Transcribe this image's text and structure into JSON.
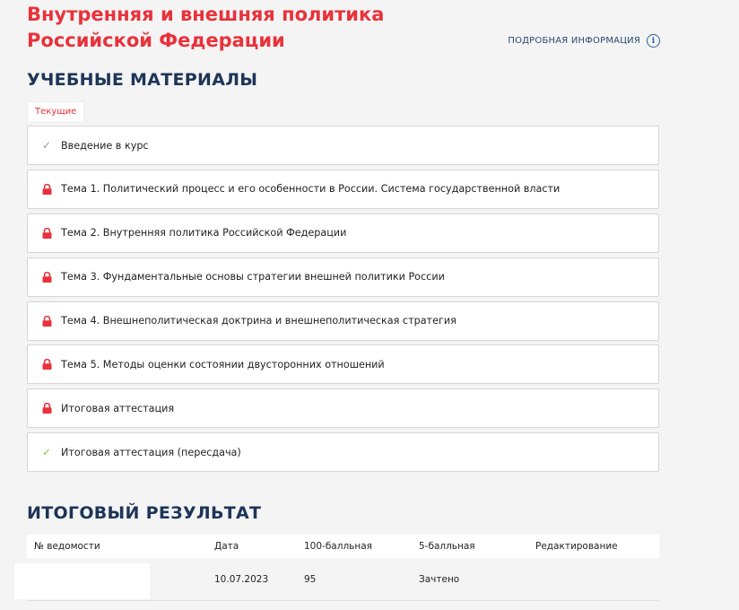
{
  "page": {
    "title": "Внутренняя и внешняя политика Российской Федерации",
    "more_info_label": "ПОДРОБНАЯ ИНФОРМАЦИЯ",
    "more_info_icon": "info-icon"
  },
  "materials": {
    "heading": "УЧЕБНЫЕ МАТЕРИАЛЫ",
    "tab_label": "Текущие",
    "items": [
      {
        "status": "done",
        "icon": "check-icon",
        "label": "Введение в курс"
      },
      {
        "status": "locked",
        "icon": "lock-icon",
        "label": "Тема 1. Политический процесс и его особенности в России. Система государственной власти"
      },
      {
        "status": "locked",
        "icon": "lock-icon",
        "label": "Тема 2. Внутренняя политика Российской Федерации"
      },
      {
        "status": "locked",
        "icon": "lock-icon",
        "label": "Тема 3. Фундаментальные основы стратегии внешней политики России"
      },
      {
        "status": "locked",
        "icon": "lock-icon",
        "label": "Тема 4. Внешнеполитическая доктрина и внешнеполитическая стратегия"
      },
      {
        "status": "locked",
        "icon": "lock-icon",
        "label": "Тема 5. Методы оценки состоянии двусторонних отношений"
      },
      {
        "status": "locked",
        "icon": "lock-icon",
        "label": "Итоговая аттестация"
      },
      {
        "status": "available",
        "icon": "check-icon",
        "label": "Итоговая аттестация (пересдача)"
      }
    ]
  },
  "results": {
    "heading": "ИТОГОВЫЙ РЕЗУЛЬТАТ",
    "columns": [
      "№ ведомости",
      "Дата",
      "100-балльная",
      "5-балльная",
      "Редактирование"
    ],
    "rows": [
      {
        "number": "",
        "date": "10.07.2023",
        "score100": "95",
        "score5": "Зачтено",
        "edit": ""
      }
    ]
  },
  "colors": {
    "accent_red": "#e8323c",
    "heading_navy": "#1d3557",
    "check_grey": "#9a9a9a",
    "check_green": "#8bc34a",
    "background": "#f4f4f4"
  }
}
